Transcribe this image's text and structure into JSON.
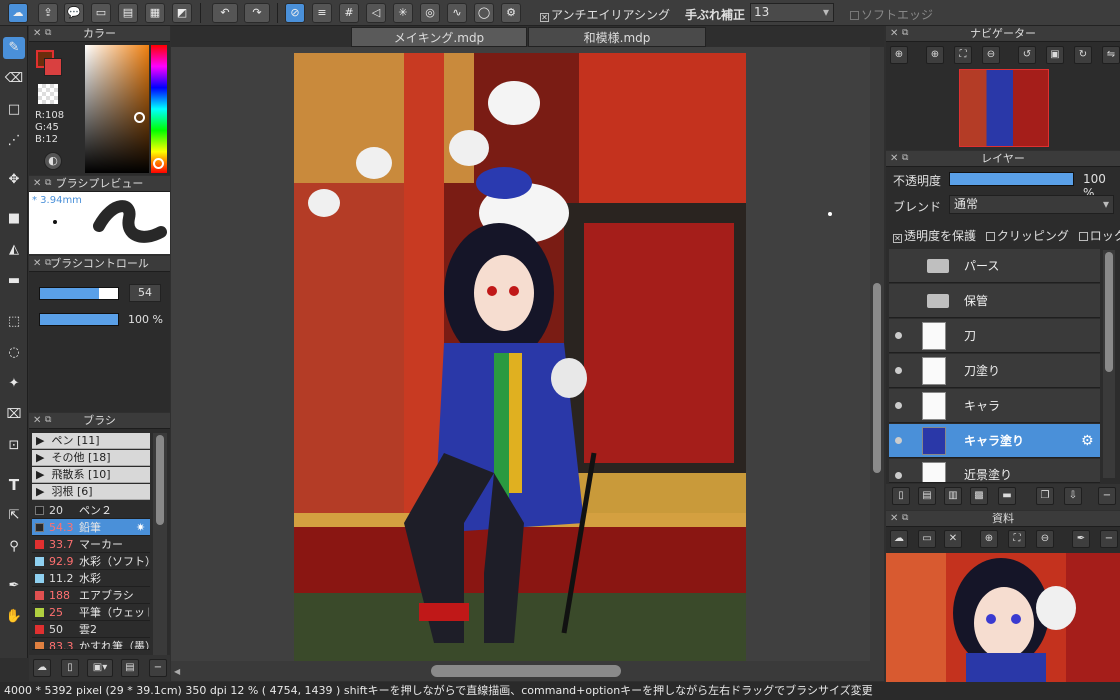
{
  "toolbar": {
    "antialias_label": "アンチエイリアシング",
    "stabilizer_label": "手ぶれ補正",
    "stabilizer_value": "13",
    "soft_edge_label": "ソフトエッジ"
  },
  "color_panel": {
    "title": "カラー",
    "r": "R:108",
    "g": "G:45",
    "b": "B:12",
    "main_color": "#6c2d0c"
  },
  "brush_preview": {
    "title": "ブラシプレビュー",
    "size": "* 3.94mm"
  },
  "brush_control": {
    "title": "ブラシコントロール",
    "size_value": "54",
    "opacity_value": "100 %"
  },
  "brush_panel": {
    "title": "ブラシ",
    "folders": [
      {
        "label": "ペン [11]"
      },
      {
        "label": "その他 [18]"
      },
      {
        "label": "飛散系 [10]"
      },
      {
        "label": "羽根 [6]"
      }
    ],
    "items": [
      {
        "size": "20",
        "name": "ペン２",
        "color": "#222222"
      },
      {
        "size": "54.3",
        "name": "鉛筆",
        "color": "#2a2a2a"
      },
      {
        "size": "33.7",
        "name": "マーカー",
        "color": "#e03030"
      },
      {
        "size": "92.9",
        "name": "水彩（ソフト）",
        "color": "#8fd0f0"
      },
      {
        "size": "11.2",
        "name": "水彩",
        "color": "#8fd0f0"
      },
      {
        "size": "188",
        "name": "エアブラシ",
        "color": "#e05050"
      },
      {
        "size": "25",
        "name": "平筆（ウェット",
        "color": "#b0d040"
      },
      {
        "size": "50",
        "name": "雲2",
        "color": "#e03030"
      },
      {
        "size": "83.3",
        "name": "かすれ筆（墨）",
        "color": "#e08040"
      }
    ]
  },
  "tabs": [
    {
      "label": "メイキング.mdp"
    },
    {
      "label": "和模様.mdp"
    }
  ],
  "navigator": {
    "title": "ナビゲーター"
  },
  "layer_panel": {
    "title": "レイヤー",
    "opacity_label": "不透明度",
    "opacity_value": "100 %",
    "opacity_fraction": 1.0,
    "blend_label": "ブレンド",
    "blend_value": "通常",
    "protect_label": "透明度を保護",
    "clip_label": "クリッピング",
    "lock_label": "ロック",
    "layers": [
      {
        "name": "パース",
        "type": "folder"
      },
      {
        "name": "保管",
        "type": "folder"
      },
      {
        "name": "刀",
        "type": "layer"
      },
      {
        "name": "刀塗り",
        "type": "layer"
      },
      {
        "name": "キャラ",
        "type": "layer"
      },
      {
        "name": "キャラ塗り",
        "type": "layer"
      },
      {
        "name": "近景塗り",
        "type": "layer"
      }
    ]
  },
  "materials": {
    "title": "資料"
  },
  "status": {
    "text": "4000 * 5392 pixel  (29 * 39.1cm)  350 dpi  12 %  ( 4754, 1439 )  shiftキーを押しながらで直線描画、command+optionキーを押しながら左右ドラッグでブラシサイズ変更"
  }
}
